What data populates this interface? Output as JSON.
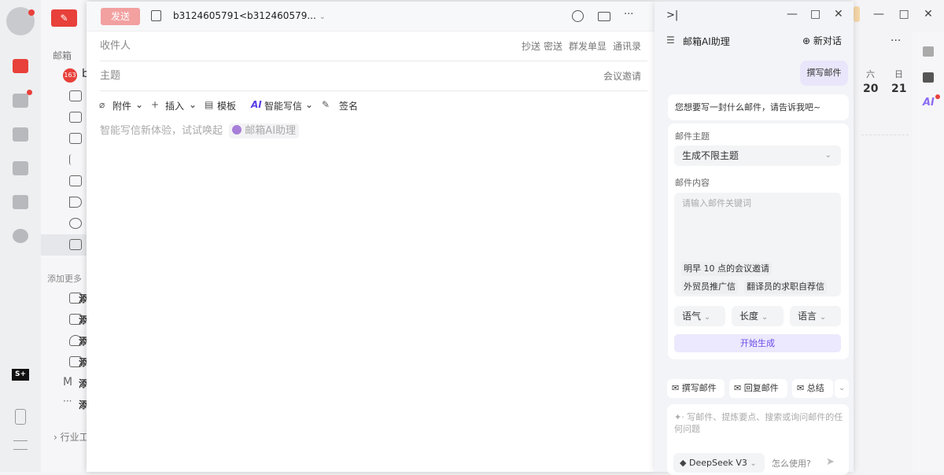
{
  "rail": {
    "icons": [
      "avatar",
      "mail-icon",
      "folder-icon",
      "calendar-icon",
      "contacts-icon",
      "ai-icon",
      "settings-icon",
      "s-plus-icon",
      "phone-icon",
      "menu-icon"
    ],
    "accent": "#e8403a"
  },
  "pane": {
    "section_label": "邮箱",
    "account_badge": "163",
    "account_initial": "b",
    "add_more_label": "添加更多",
    "add_items": [
      "添",
      "添",
      "添",
      "添",
      "添",
      "添"
    ],
    "industry_label": "行业工"
  },
  "compose": {
    "send_label": "发送",
    "from": "b3124605791<b312460579...",
    "to_label": "收件人",
    "cc": "抄送",
    "bcc": "密送",
    "separate": "群发单显",
    "contacts": "通讯录",
    "subject_label": "主题",
    "meeting": "会议邀请",
    "toolbar": {
      "attach": "附件",
      "insert": "插入",
      "template": "模板",
      "ai_badge": "AI",
      "ai_write": "智能写信",
      "signature": "签名"
    },
    "hint": "智能写信新体验，试试唤起",
    "hint_link": "邮箱AI助理"
  },
  "ai_panel": {
    "title": "邮箱AI助理",
    "new_chat": "新对话",
    "user_msg": "撰写邮件",
    "bot_msg": "您想要写一封什么邮件，请告诉我吧~",
    "subject_label": "邮件主题",
    "subject_value": "生成不限主题",
    "content_label": "邮件内容",
    "content_placeholder": "请输入邮件关键词",
    "suggestions": [
      "明早 10 点的会议邀请",
      "外贸员推广信",
      "翻译员的求职自荐信"
    ],
    "tone": "语气",
    "length": "长度",
    "language": "语言",
    "generate": "开始生成",
    "quick": [
      "撰写邮件",
      "回复邮件",
      "总结"
    ],
    "input_placeholder": "写邮件、提炼要点、搜索或询问邮件的任何问题",
    "model": "DeepSeek V3",
    "help": "怎么使用?",
    "accent": "#6b4de6"
  },
  "background": {
    "sat": "六",
    "sat_date": "20",
    "sun": "日",
    "sun_date": "21"
  }
}
